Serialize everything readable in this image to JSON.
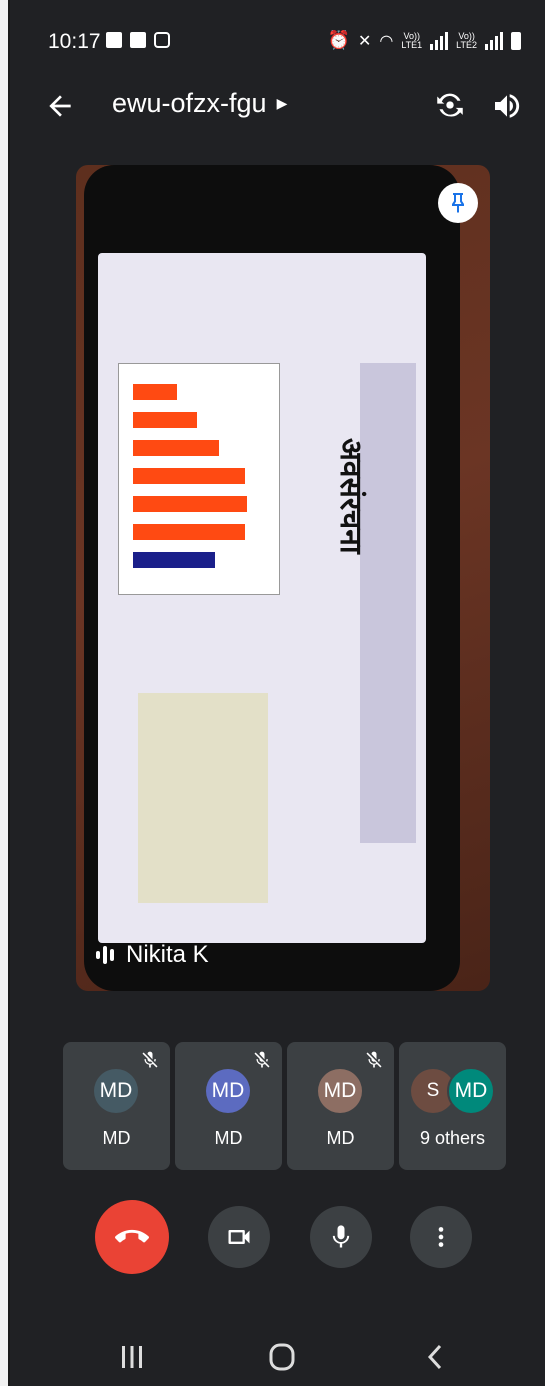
{
  "status_bar": {
    "time": "10:17",
    "lte1": "Vo))\nLTE1",
    "lte2": "Vo))\nLTE2"
  },
  "header": {
    "meeting_code": "ewu-ofzx-fgu"
  },
  "presenter": {
    "name": "Nikita K",
    "slide_title": "अवसंरचना"
  },
  "participants": [
    {
      "initials": "MD",
      "label": "MD",
      "color": "#455a64",
      "muted": true
    },
    {
      "initials": "MD",
      "label": "MD",
      "color": "#5c6bc0",
      "muted": true
    },
    {
      "initials": "MD",
      "label": "MD",
      "color": "#8d6e63",
      "muted": true
    }
  ],
  "others": {
    "avatar1": "S",
    "avatar2": "MD",
    "label": "9 others"
  },
  "colors": {
    "end_call": "#ea4335",
    "control_bg": "#3c4043",
    "background": "#202124"
  },
  "icons": [
    "back-arrow-icon",
    "switch-camera-icon",
    "speaker-icon",
    "pin-icon",
    "mic-off-icon",
    "end-call-icon",
    "video-camera-icon",
    "microphone-icon",
    "more-vert-icon",
    "recents-icon",
    "home-icon",
    "nav-back-icon"
  ]
}
